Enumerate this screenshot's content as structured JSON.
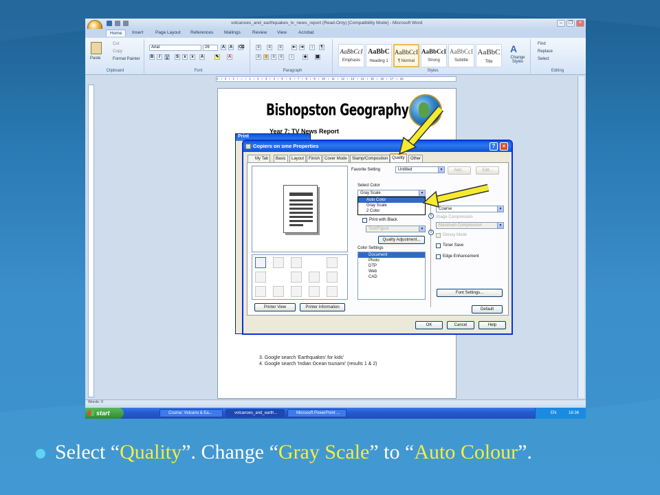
{
  "window": {
    "title": "volcanoes_and_earthquakes_tv_news_report (Read-Only) [Compatibility Mode] - Microsoft Word"
  },
  "ribbon": {
    "tabs": [
      "Home",
      "Insert",
      "Page Layout",
      "References",
      "Mailings",
      "Review",
      "View",
      "Acrobat"
    ],
    "clipboard": {
      "label": "Clipboard",
      "paste": "Paste",
      "cut": "Cut",
      "copy": "Copy",
      "format_painter": "Format Painter"
    },
    "font": {
      "label": "Font",
      "name": "Arial",
      "size": "26"
    },
    "paragraph": {
      "label": "Paragraph"
    },
    "styles": {
      "label": "Styles",
      "items": [
        {
          "sample": "AaBbCcI",
          "name": "Emphasis"
        },
        {
          "sample": "AaBbC",
          "name": "Heading 1"
        },
        {
          "sample": "AaBbCcI",
          "name": "¶ Normal"
        },
        {
          "sample": "AaBbCcI",
          "name": "Strong"
        },
        {
          "sample": "AaBbCcI",
          "name": "Subtitle"
        },
        {
          "sample": "AaBbC",
          "name": "Title"
        }
      ],
      "change": "Change Styles"
    },
    "editing": {
      "label": "Editing",
      "find": "Find",
      "replace": "Replace",
      "select": "Select"
    }
  },
  "ruler": {
    "text": "3 · ı · 2 · ı · 1 · ı · ⌂ · ı · 1 · ı · 2 · ı · 3 · ı · 4 · ı · 5 · ı · 6 · ı · 7 · ı · 8 · ı · 9 · ı · 10 · ı · 11 · ı · 12 · ı · 13 · ı · 14 · ı · 15 · ı · 16 · ı · 17 · ı · 18"
  },
  "document": {
    "heading": "Bishopston Geography",
    "subheading": "Year 7: TV News Report",
    "items": [
      "3.  Google search 'Earthquakes' for kids'",
      "4.  Google search 'Indian Ocean tsunami' (results 1 & 2)"
    ]
  },
  "statusbar": {
    "words": "Words: 0"
  },
  "back_dialog": {
    "title": "Print"
  },
  "dialog": {
    "title": "Copiers on sme Properties",
    "tabs": [
      "My Tab",
      "Basic",
      "Layout",
      "Finish",
      "Cover Mode",
      "Stamp/Composition",
      "Quality",
      "Other"
    ],
    "favorite_label": "Favorite Setting",
    "favorite_value": "Untitled",
    "add": "Add...",
    "edit": "Edit...",
    "select_color_label": "Select Color",
    "select_color_value": "Gray Scale",
    "dropdown_options": [
      "Auto Color",
      "Gray Scale",
      "2 Color"
    ],
    "print_with_black": "Print with Black",
    "text_figure": "Text/Figure",
    "quality_adjustment": "Quality Adjustment...",
    "color_settings_label": "Color Settings",
    "color_settings": [
      "Document",
      "Photo",
      "DTP",
      "Web",
      "CAD"
    ],
    "resolution_value": "Coarse",
    "image_compression": "Image Compression",
    "compression_value": "Maximum Compression",
    "glossy": "Glossy Mode",
    "toner_save": "Toner Save",
    "edge": "Edge Enhancement",
    "font_settings": "Font Settings...",
    "default": "Default",
    "printer_view": "Printer View",
    "printer_info": "Printer Information",
    "ok": "OK",
    "cancel": "Cancel",
    "help": "Help"
  },
  "taskbar": {
    "start": "start",
    "tasks": [
      "Course: Volcano & Ea...",
      "volcanoes_and_earth...",
      "Microsoft PowerPoint ..."
    ],
    "lang": "EN",
    "time": "16:36"
  },
  "caption": {
    "p1": "Select “",
    "q1": "Quality",
    "p2": "”. Change “",
    "q2": "Gray Scale",
    "p3": "” to “",
    "q3": "Auto Colour",
    "p4": "”."
  },
  "colors": {
    "accent_yellow": "#f7ef3a",
    "bullet": "#5fd4f4",
    "xp_blue": "#0a5ade"
  }
}
